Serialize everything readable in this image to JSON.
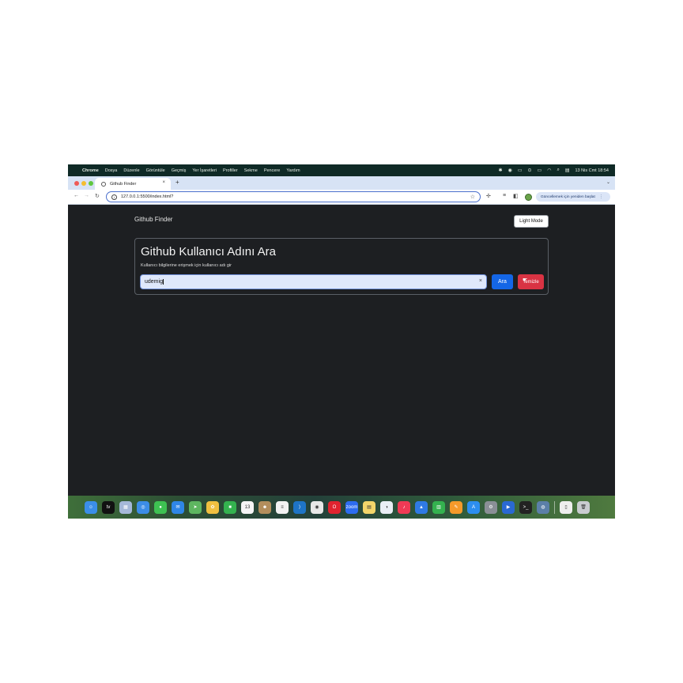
{
  "menubar": {
    "items": [
      "Chrome",
      "Dosya",
      "Düzenle",
      "Görüntüle",
      "Geçmiş",
      "Yer İşaretleri",
      "Profiller",
      "Sekme",
      "Pencere",
      "Yardım"
    ],
    "datetime": "13 Nis Cmt  18:54"
  },
  "browser": {
    "tab_title": "Github Finder",
    "url": "127.0.0.1:5500/index.html?",
    "update_button": "Güncellemek için yeniden başlat"
  },
  "page": {
    "brand": "Github Finder",
    "theme_toggle": "Light Mode",
    "card": {
      "title": "Github Kullanıcı Adını Ara",
      "subtitle": "Kullanıcı bilgilerine erişmek için kullanıcı adı gir",
      "input_value": "udemig",
      "search_button": "Ara",
      "clear_button": "Temizle"
    }
  },
  "dock": {
    "icons": [
      {
        "name": "finder-icon",
        "color": "#3b8ee8",
        "glyph": "☺"
      },
      {
        "name": "apple-tv-icon",
        "color": "#111111",
        "glyph": "tv"
      },
      {
        "name": "launchpad-icon",
        "color": "#a5b8d8",
        "glyph": "▦"
      },
      {
        "name": "safari-icon",
        "color": "#3c8de6",
        "glyph": "◎"
      },
      {
        "name": "messages-icon",
        "color": "#3ec152",
        "glyph": "●"
      },
      {
        "name": "mail-icon",
        "color": "#2f86e6",
        "glyph": "✉"
      },
      {
        "name": "maps-icon",
        "color": "#5eb660",
        "glyph": "➤"
      },
      {
        "name": "photos-icon",
        "color": "#f0c040",
        "glyph": "✿"
      },
      {
        "name": "facetime-icon",
        "color": "#34b24f",
        "glyph": "■"
      },
      {
        "name": "calendar-icon",
        "color": "#f5f5f5",
        "glyph": "13"
      },
      {
        "name": "contacts-icon",
        "color": "#b38e5c",
        "glyph": "☻"
      },
      {
        "name": "reminders-icon",
        "color": "#f2f2f2",
        "glyph": "≡"
      },
      {
        "name": "vscode-icon",
        "color": "#1e74c6",
        "glyph": "⟩"
      },
      {
        "name": "chrome-icon",
        "color": "#e8e8e8",
        "glyph": "◉"
      },
      {
        "name": "opera-icon",
        "color": "#e0232f",
        "glyph": "O"
      },
      {
        "name": "zoom-icon",
        "color": "#2d6cf0",
        "glyph": "zoom"
      },
      {
        "name": "notes-icon",
        "color": "#f3d66a",
        "glyph": "▤"
      },
      {
        "name": "freeform-icon",
        "color": "#e9eef5",
        "glyph": "◑"
      },
      {
        "name": "music-icon",
        "color": "#f03a55",
        "glyph": "♪"
      },
      {
        "name": "keynote-icon",
        "color": "#2f7ae5",
        "glyph": "▲"
      },
      {
        "name": "numbers-icon",
        "color": "#34b24f",
        "glyph": "▥"
      },
      {
        "name": "pages-icon",
        "color": "#f49a2a",
        "glyph": "✎"
      },
      {
        "name": "app-store-icon",
        "color": "#2c8ef0",
        "glyph": "A"
      },
      {
        "name": "system-settings-icon",
        "color": "#8a8f96",
        "glyph": "⚙"
      },
      {
        "name": "quicktime-icon",
        "color": "#2a69d3",
        "glyph": "▶"
      },
      {
        "name": "terminal-icon",
        "color": "#222222",
        "glyph": ">_"
      },
      {
        "name": "screen-recorder-icon",
        "color": "#5b7fa8",
        "glyph": "◍"
      },
      {
        "name": "documents-icon",
        "color": "#eeeeee",
        "glyph": "▯"
      },
      {
        "name": "trash-icon",
        "color": "#c9ccd0",
        "glyph": "🗑"
      }
    ]
  }
}
